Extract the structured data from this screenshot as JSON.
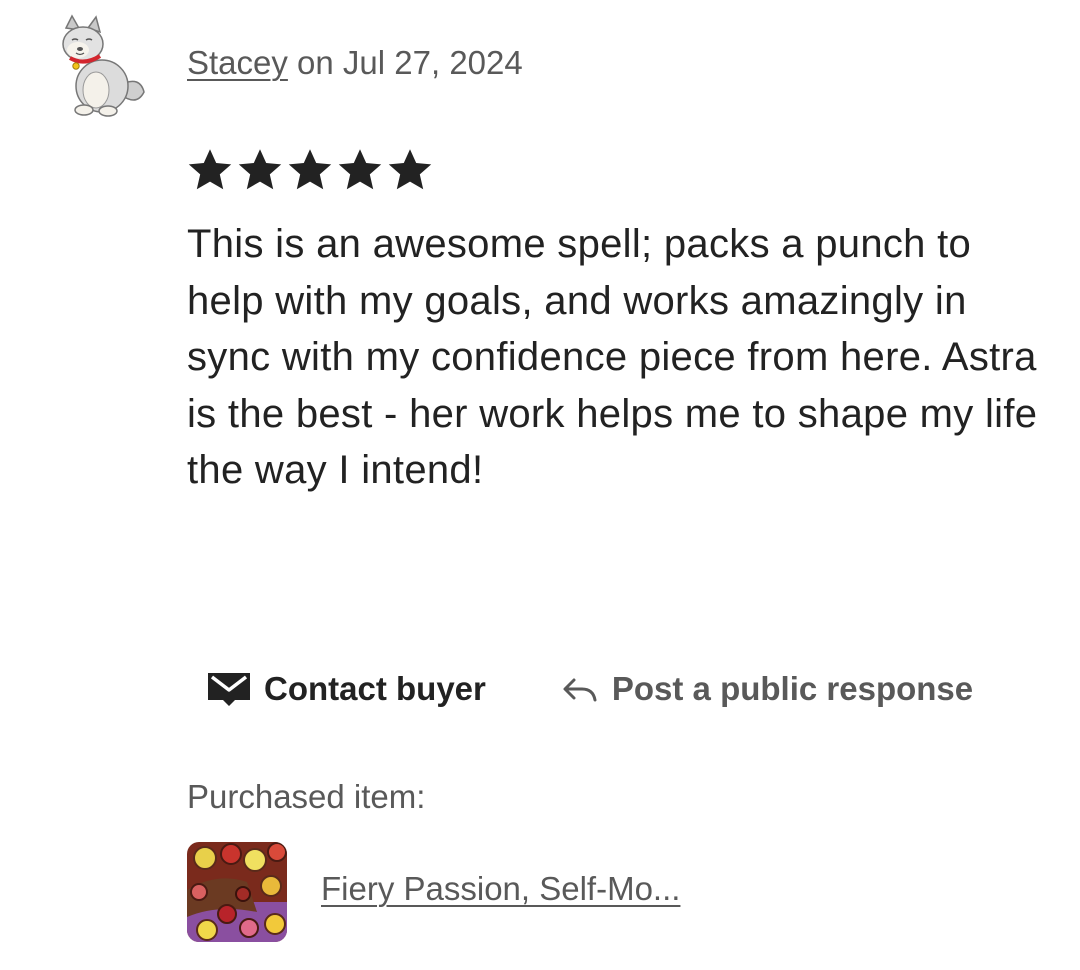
{
  "review": {
    "reviewer_name": "Stacey",
    "date_text": " on Jul 27, 2024",
    "rating": 5,
    "rating_max": 5,
    "text": "This is an awesome spell; packs a punch to help with my goals, and works amazingly in sync with my confidence piece from here. Astra is the best - her work helps me to shape my life the way I intend!"
  },
  "actions": {
    "contact_label": "Contact buyer",
    "respond_label": "Post a public response"
  },
  "purchased": {
    "label": "Purchased item:",
    "item_title": "Fiery Passion, Self-Mo..."
  },
  "icons": {
    "star": "star-icon",
    "contact": "envelope-icon",
    "respond": "reply-arrow-icon",
    "avatar": "dog-avatar"
  },
  "colors": {
    "primary_text": "#222222",
    "secondary_text": "#595959",
    "star": "#222222"
  }
}
